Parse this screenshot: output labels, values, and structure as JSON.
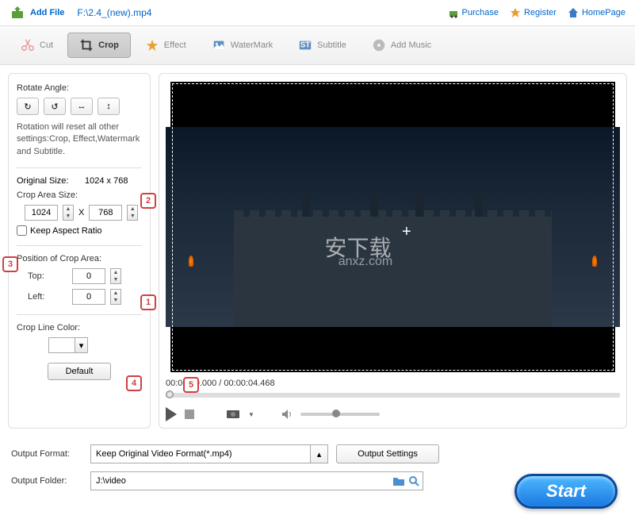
{
  "topbar": {
    "add_file": "Add File",
    "file_path": "F:\\2.4_(new).mp4",
    "purchase": "Purchase",
    "register": "Register",
    "homepage": "HomePage"
  },
  "tabs": {
    "cut": "Cut",
    "crop": "Crop",
    "effect": "Effect",
    "watermark": "WaterMark",
    "subtitle": "Subtitle",
    "addmusic": "Add Music"
  },
  "panel": {
    "rotate_angle": "Rotate Angle:",
    "rotation_hint": "Rotation will reset all other settings:Crop, Effect,Watermark and Subtitle.",
    "original_size_label": "Original Size:",
    "original_size_value": "1024 x 768",
    "crop_area_size": "Crop Area Size:",
    "width": "1024",
    "x": "X",
    "height": "768",
    "keep_aspect": "Keep Aspect Ratio",
    "position_label": "Position of Crop Area:",
    "top_label": "Top:",
    "top_value": "0",
    "left_label": "Left:",
    "left_value": "0",
    "crop_line_color": "Crop Line Color:",
    "default_btn": "Default"
  },
  "callouts": {
    "c1": "1",
    "c2": "2",
    "c3": "3",
    "c4": "4",
    "c5": "5"
  },
  "video": {
    "watermark1": "安下载",
    "watermark2": "anxz.com",
    "time": "00:00:00.000 / 00:00:04.468"
  },
  "output": {
    "format_label": "Output Format:",
    "format_value": "Keep Original Video Format(*.mp4)",
    "settings_btn": "Output Settings",
    "folder_label": "Output Folder:",
    "folder_value": "J:\\video",
    "start": "Start"
  }
}
